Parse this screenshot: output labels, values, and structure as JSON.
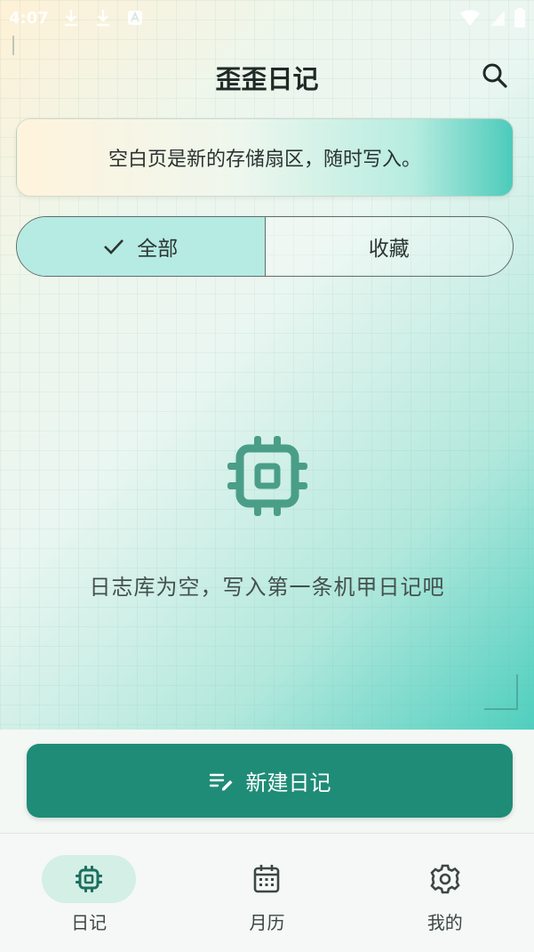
{
  "status_bar": {
    "time": "4:07"
  },
  "header": {
    "title": "歪歪日记",
    "search_icon": "search-icon"
  },
  "banner": {
    "text": "空白页是新的存储扇区，随时写入。"
  },
  "filter": {
    "options": [
      {
        "label": "全部",
        "selected": true
      },
      {
        "label": "收藏",
        "selected": false
      }
    ]
  },
  "empty_state": {
    "icon": "chip-icon",
    "message": "日志库为空，写入第一条机甲日记吧"
  },
  "new_entry_button": {
    "label": "新建日记",
    "icon": "edit-note-icon"
  },
  "bottom_nav": {
    "items": [
      {
        "label": "日记",
        "icon": "chip-icon",
        "active": true
      },
      {
        "label": "月历",
        "icon": "calendar-icon",
        "active": false
      },
      {
        "label": "我的",
        "icon": "gear-icon",
        "active": false
      }
    ]
  },
  "colors": {
    "primary": "#1f8c77",
    "accent_light": "#b5ebe3",
    "icon_green": "#4a9e87",
    "nav_active_bg": "#d3efe6"
  }
}
